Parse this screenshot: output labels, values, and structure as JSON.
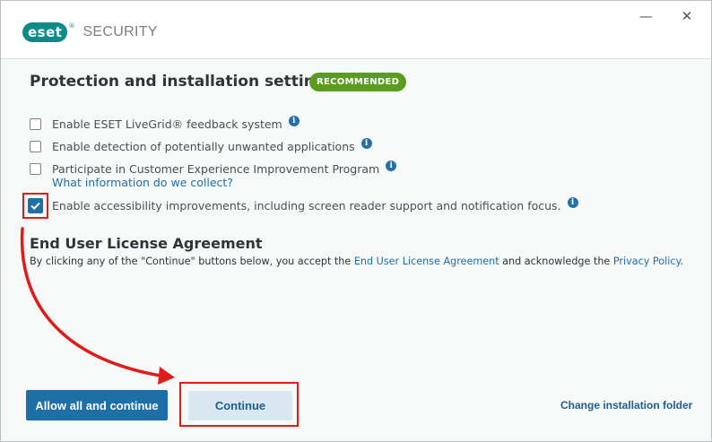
{
  "window": {
    "logo_text": "eset",
    "product_name": "SECURITY",
    "minimize_glyph": "—",
    "close_glyph": "✕"
  },
  "protection": {
    "title": "Protection and installation settings",
    "badge": "RECOMMENDED",
    "options": [
      {
        "label": "Enable ESET LiveGrid® feedback system",
        "checked": false,
        "icon": "info-icon"
      },
      {
        "label": "Enable detection of potentially unwanted applications",
        "checked": false,
        "icon": "info-icon"
      },
      {
        "label": "Participate in Customer Experience Improvement Program",
        "checked": false,
        "icon": "info-icon"
      },
      {
        "label": "Enable accessibility improvements, including screen reader support and notification focus.",
        "checked": true,
        "icon": "info-icon"
      }
    ],
    "what_info_link": "What information do we collect?",
    "info_glyph": "i"
  },
  "eula": {
    "title": "End User License Agreement",
    "text_before": "By clicking any of the \"Continue\" buttons below, you accept the ",
    "eula_link": "End User License Agreement",
    "text_middle": " and acknowledge the ",
    "privacy_link": "Privacy Policy",
    "text_after": "."
  },
  "footer": {
    "allow_all_label": "Allow all and continue",
    "continue_label": "Continue",
    "change_folder_label": "Change installation folder"
  },
  "colors": {
    "accent": "#1e6fa8",
    "badge_green": "#5a9d1e",
    "annotation_red": "#e11a1a"
  }
}
